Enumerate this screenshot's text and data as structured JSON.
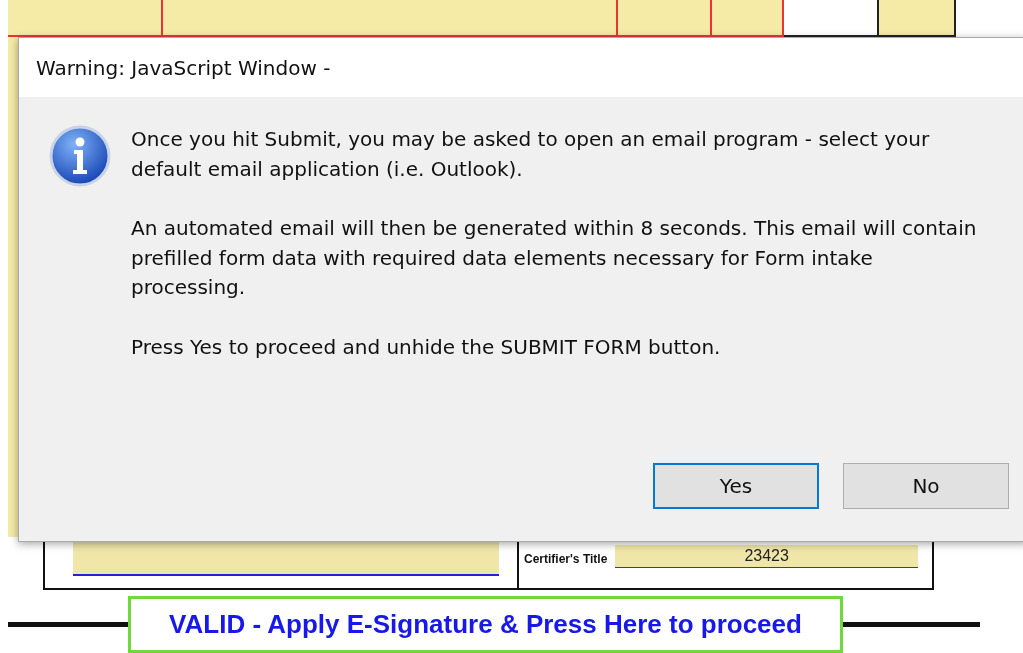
{
  "dialog": {
    "title": "Warning: JavaScript Window -",
    "paragraphs": [
      "Once you hit Submit, you may be asked to open an email program - select your default email application (i.e. Outlook).",
      "An automated email will then be generated within 8 seconds. This email will contain prefilled form data with required data elements necessary for Form intake processing.",
      "Press Yes to proceed and unhide the SUBMIT FORM button."
    ],
    "buttons": [
      {
        "label": "Yes",
        "selected": true
      },
      {
        "label": "No",
        "selected": false
      }
    ]
  },
  "form": {
    "certifier_title_label": "Certifier's Title",
    "certifier_title_value": "23423",
    "proceed_button": "VALID - Apply E-Signature & Press Here to proceed"
  }
}
